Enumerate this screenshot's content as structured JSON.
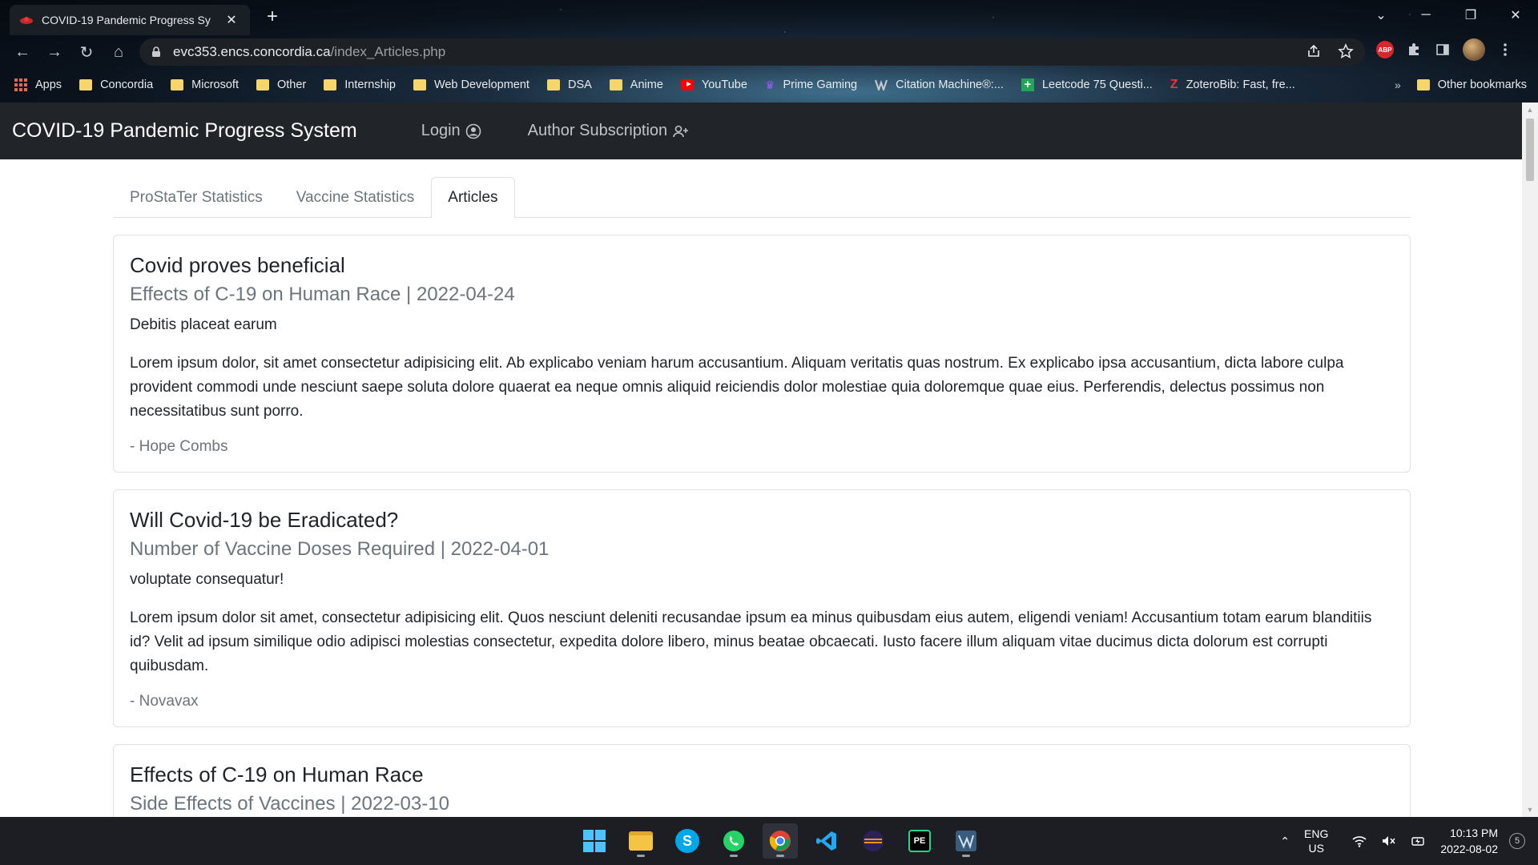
{
  "browser": {
    "tab_title": "COVID-19 Pandemic Progress Sy",
    "tab_close": "✕",
    "new_tab": "+",
    "url_host": "evc353.encs.concordia.ca",
    "url_path": "/index_Articles.php",
    "window_controls": {
      "collapse": "⌄",
      "minimize": "─",
      "restore": "❐",
      "close": "✕"
    },
    "nav": {
      "back": "←",
      "forward": "→",
      "reload": "↻",
      "home": "⌂"
    },
    "bookmarks": [
      {
        "label": "Apps",
        "icon": "apps-grid-icon"
      },
      {
        "label": "Concordia",
        "icon": "folder-icon"
      },
      {
        "label": "Microsoft",
        "icon": "folder-icon"
      },
      {
        "label": "Other",
        "icon": "folder-icon"
      },
      {
        "label": "Internship",
        "icon": "folder-icon"
      },
      {
        "label": "Web Development",
        "icon": "folder-icon"
      },
      {
        "label": "DSA",
        "icon": "folder-icon"
      },
      {
        "label": "Anime",
        "icon": "folder-icon"
      },
      {
        "label": "YouTube",
        "icon": "youtube-icon"
      },
      {
        "label": "Prime Gaming",
        "icon": "crown-icon"
      },
      {
        "label": "Citation Machine®:...",
        "icon": "citation-icon"
      },
      {
        "label": "Leetcode 75 Questi...",
        "icon": "sheets-icon"
      },
      {
        "label": "ZoteroBib: Fast, fre...",
        "icon": "zotero-icon"
      }
    ],
    "bookmarks_overflow": "»",
    "other_bookmarks": "Other bookmarks",
    "abp_label": "ABP"
  },
  "site": {
    "brand": "COVID-19 Pandemic Progress System",
    "nav_login": "Login",
    "nav_subscription": "Author Subscription",
    "tabs": [
      {
        "label": "ProStaTer Statistics",
        "active": false
      },
      {
        "label": "Vaccine Statistics",
        "active": false
      },
      {
        "label": "Articles",
        "active": true
      }
    ],
    "articles": [
      {
        "title": "Covid proves beneficial",
        "subtitle": "Effects of C-19 on Human Race | 2022-04-24",
        "lead": "Debitis placeat earum",
        "body": "Lorem ipsum dolor, sit amet consectetur adipisicing elit. Ab explicabo veniam harum accusantium. Aliquam veritatis quas nostrum. Ex explicabo ipsa accusantium, dicta labore culpa provident commodi unde nesciunt saepe soluta dolore quaerat ea neque omnis aliquid reiciendis dolor molestiae quia doloremque quae eius. Perferendis, delectus possimus non necessitatibus sunt porro.",
        "author": "- Hope Combs"
      },
      {
        "title": "Will Covid-19 be Eradicated?",
        "subtitle": "Number of Vaccine Doses Required | 2022-04-01",
        "lead": "voluptate consequatur!",
        "body": "Lorem ipsum dolor sit amet, consectetur adipisicing elit. Quos nesciunt deleniti recusandae ipsum ea minus quibusdam eius autem, eligendi veniam! Accusantium totam earum blanditiis id? Velit ad ipsum similique odio adipisci molestias consectetur, expedita dolore libero, minus beatae obcaecati. Iusto facere illum aliquam vitae ducimus dicta dolorum est corrupti quibusdam.",
        "author": "- Novavax"
      },
      {
        "title": "Effects of C-19 on Human Race",
        "subtitle": "Side Effects of Vaccines | 2022-03-10",
        "lead": "",
        "body": "",
        "author": ""
      }
    ]
  },
  "taskbar": {
    "lang_top": "ENG",
    "lang_bottom": "US",
    "time": "10:13 PM",
    "date": "2022-08-02",
    "notifications": "5",
    "tray_chevron": "⌃",
    "skype_letter": "S",
    "pycharm_label": "PE"
  },
  "colors": {
    "navbar_bg": "#212529",
    "accent_blue": "#4cc2ff",
    "muted_text": "#6c757d"
  }
}
